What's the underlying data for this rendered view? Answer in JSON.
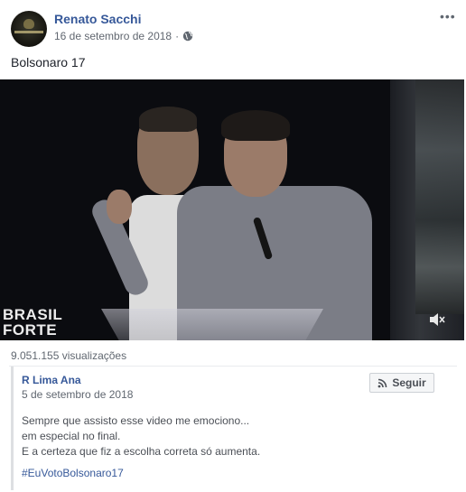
{
  "post": {
    "author": "Renato Sacchi",
    "date": "16 de setembro de 2018",
    "separator": "·",
    "privacy_icon": "globe-icon",
    "more_label": "•••",
    "text": "Bolsonaro 17"
  },
  "video": {
    "overlay_line1": "BRASIL",
    "overlay_line2": "FORTE",
    "mute_icon": "speaker-muted-icon"
  },
  "views": "9.051.155 visualizações",
  "shared_post": {
    "author": "R Lima Ana",
    "date": "5 de setembro de 2018",
    "follow_label": "Seguir",
    "lines": [
      "Sempre que assisto esse video me emociono...",
      "em especial no final.",
      "E a certeza que fiz a escolha correta só aumenta."
    ],
    "hashtag": "#EuVotoBolsonaro17"
  },
  "colors": {
    "link": "#365899",
    "meta": "#606770",
    "text": "#1d2129"
  }
}
